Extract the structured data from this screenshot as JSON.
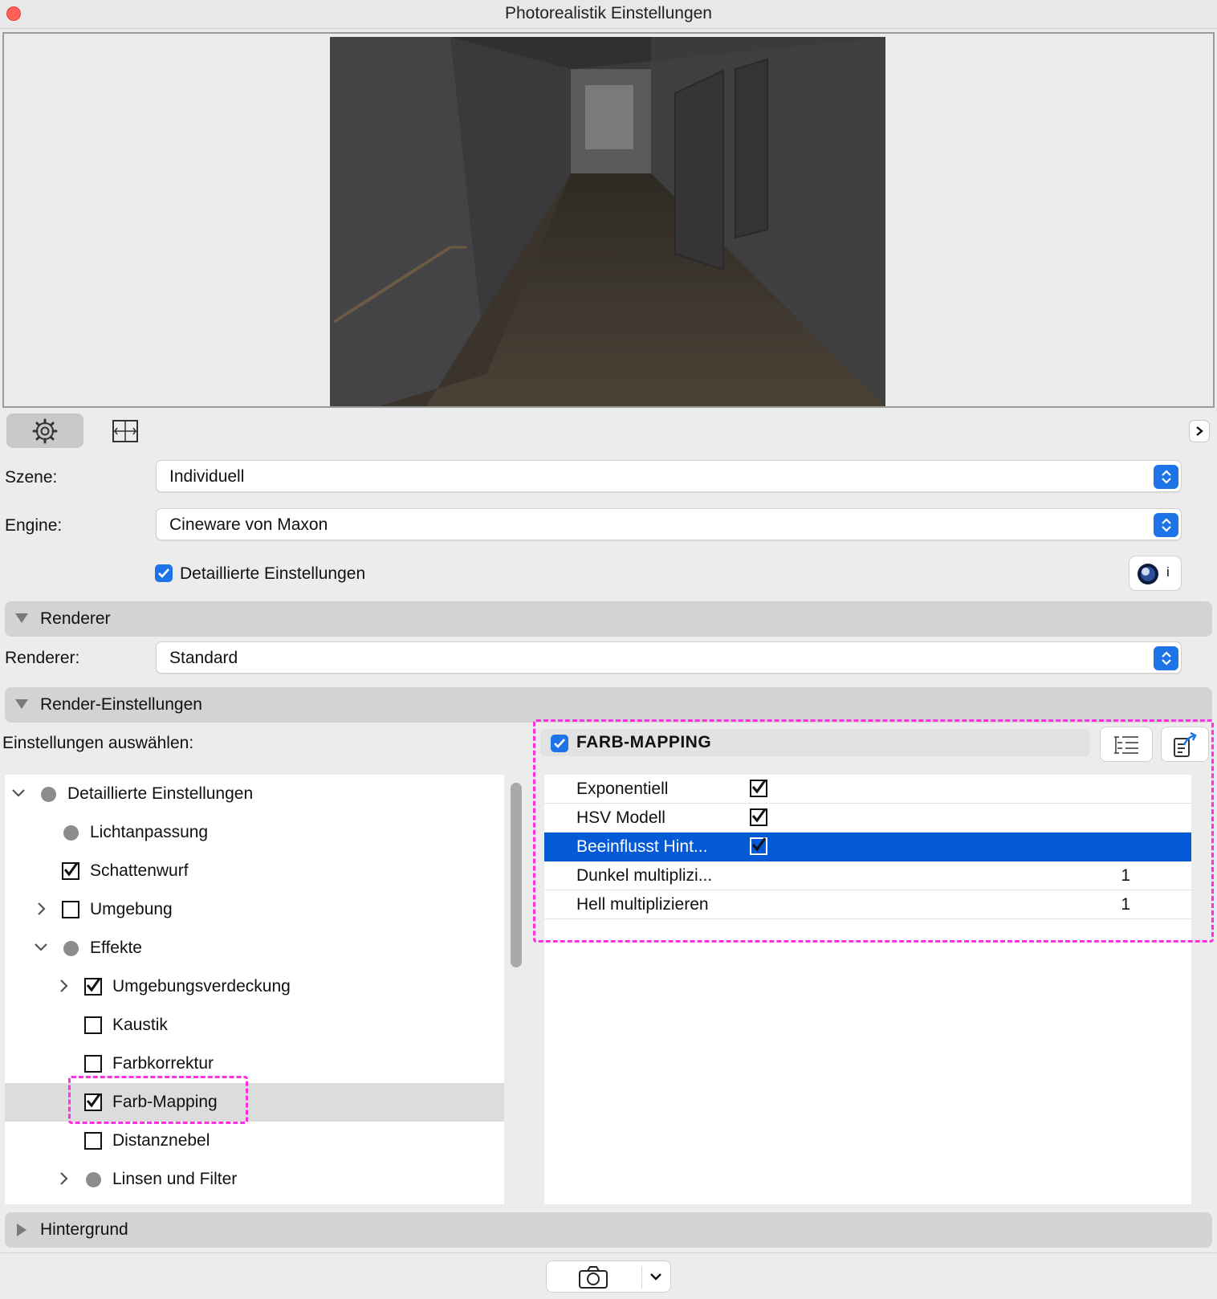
{
  "window": {
    "title": "Photorealistik Einstellungen"
  },
  "toolbar": {
    "tabs": [
      {
        "icon": "gear-icon",
        "active": true
      },
      {
        "icon": "frame-icon",
        "active": false
      }
    ]
  },
  "form": {
    "szene_label": "Szene:",
    "szene_value": "Individuell",
    "engine_label": "Engine:",
    "engine_value": "Cineware von Maxon",
    "detailed_label": "Detaillierte Einstellungen",
    "detailed_checked": true,
    "info_label": "i"
  },
  "sections": {
    "renderer": "Renderer",
    "render_settings": "Render-Einstellungen",
    "background": "Hintergrund"
  },
  "renderer": {
    "label": "Renderer:",
    "value": "Standard"
  },
  "settings": {
    "select_label": "Einstellungen auswählen:",
    "tree": [
      {
        "label": "Detaillierte Einstellungen",
        "level": 0,
        "state": "disc",
        "expand": "open"
      },
      {
        "label": "Lichtanpassung",
        "level": 1,
        "state": "disc",
        "expand": "none"
      },
      {
        "label": "Schattenwurf",
        "level": 1,
        "state": "checked",
        "expand": "none"
      },
      {
        "label": "Umgebung",
        "level": 1,
        "state": "unchecked",
        "expand": "closed"
      },
      {
        "label": "Effekte",
        "level": 1,
        "state": "disc",
        "expand": "open"
      },
      {
        "label": "Umgebungsverdeckung",
        "level": 2,
        "state": "checked",
        "expand": "closed"
      },
      {
        "label": "Kaustik",
        "level": 2,
        "state": "unchecked",
        "expand": "none"
      },
      {
        "label": "Farbkorrektur",
        "level": 2,
        "state": "unchecked",
        "expand": "none"
      },
      {
        "label": "Farb-Mapping",
        "level": 2,
        "state": "checked",
        "expand": "none",
        "selected": true
      },
      {
        "label": "Distanznebel",
        "level": 2,
        "state": "unchecked",
        "expand": "none"
      },
      {
        "label": "Linsen und Filter",
        "level": 2,
        "state": "disc",
        "expand": "closed"
      }
    ]
  },
  "farb_mapping": {
    "title": "FARB-MAPPING",
    "enabled": true,
    "rows": [
      {
        "name": "Exponentiell",
        "checked": true,
        "value": ""
      },
      {
        "name": "HSV Modell",
        "checked": true,
        "value": ""
      },
      {
        "name": "Beeinflusst Hint...",
        "checked": true,
        "value": "",
        "selected": true
      },
      {
        "name": "Dunkel multiplizi...",
        "checked": null,
        "value": "1"
      },
      {
        "name": "Hell multiplizieren",
        "checked": null,
        "value": "1"
      }
    ]
  },
  "footer": {
    "camera_icon": "camera-icon"
  },
  "colors": {
    "accent": "#1c74e8",
    "selection": "#0359d6",
    "highlight": "#ff2fe3"
  }
}
